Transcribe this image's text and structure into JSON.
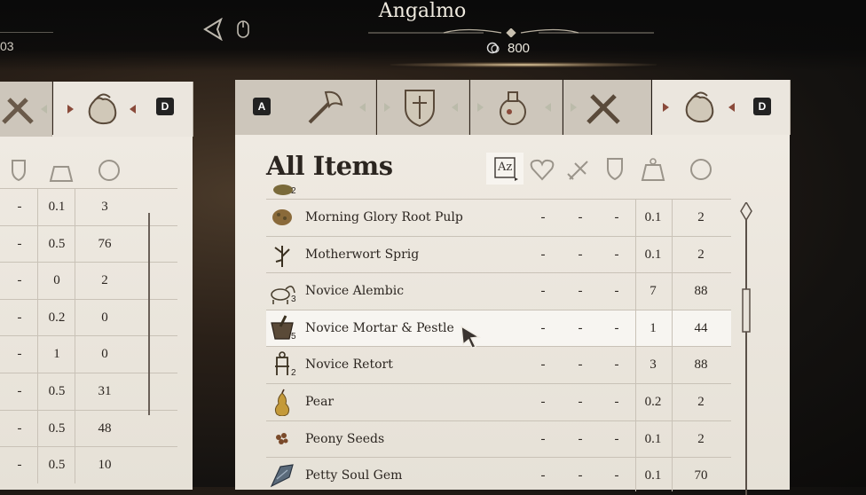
{
  "header": {
    "merchant_name": "Angalmo",
    "gold": "800",
    "left_value_fragment": "03"
  },
  "main_panel": {
    "title": "All Items",
    "tab_key_left": "A",
    "tab_key_right": "D",
    "sort_label": "Az",
    "rows": [
      {
        "name": "Morning Glory Root Pulp",
        "icon": "root-pulp-icon",
        "qty": "",
        "c1": "-",
        "c2": "-",
        "c3": "-",
        "weight": "0.1",
        "value": "2"
      },
      {
        "name": "Motherwort Sprig",
        "icon": "sprig-icon",
        "qty": "",
        "c1": "-",
        "c2": "-",
        "c3": "-",
        "weight": "0.1",
        "value": "2"
      },
      {
        "name": "Novice Alembic",
        "icon": "alembic-icon",
        "qty": "3",
        "c1": "-",
        "c2": "-",
        "c3": "-",
        "weight": "7",
        "value": "88"
      },
      {
        "name": "Novice Mortar & Pestle",
        "icon": "mortar-icon",
        "qty": "5",
        "c1": "-",
        "c2": "-",
        "c3": "-",
        "weight": "1",
        "value": "44"
      },
      {
        "name": "Novice Retort",
        "icon": "retort-icon",
        "qty": "2",
        "c1": "-",
        "c2": "-",
        "c3": "-",
        "weight": "3",
        "value": "88"
      },
      {
        "name": "Pear",
        "icon": "pear-icon",
        "qty": "",
        "c1": "-",
        "c2": "-",
        "c3": "-",
        "weight": "0.2",
        "value": "2"
      },
      {
        "name": "Peony Seeds",
        "icon": "seeds-icon",
        "qty": "",
        "c1": "-",
        "c2": "-",
        "c3": "-",
        "weight": "0.1",
        "value": "2"
      },
      {
        "name": "Petty Soul Gem",
        "icon": "soul-gem-icon",
        "qty": "",
        "c1": "-",
        "c2": "-",
        "c3": "-",
        "weight": "0.1",
        "value": "70"
      }
    ],
    "partial_top_qty": "2"
  },
  "left_panel": {
    "tab_key": "D",
    "rows": [
      {
        "c1": "-",
        "weight": "0.1",
        "value": "3"
      },
      {
        "c1": "-",
        "weight": "0.5",
        "value": "76"
      },
      {
        "c1": "-",
        "weight": "0",
        "value": "2"
      },
      {
        "c1": "-",
        "weight": "0.2",
        "value": "0"
      },
      {
        "c1": "-",
        "weight": "1",
        "value": "0"
      },
      {
        "c1": "-",
        "weight": "0.5",
        "value": "31"
      },
      {
        "c1": "-",
        "weight": "0.5",
        "value": "48"
      },
      {
        "c1": "-",
        "weight": "0.5",
        "value": "10"
      }
    ]
  },
  "colors": {
    "parchment": "#e8e3da",
    "tab": "#cdc6bb",
    "accent_arrow": "#8a4a3a",
    "text": "#2b2520"
  }
}
